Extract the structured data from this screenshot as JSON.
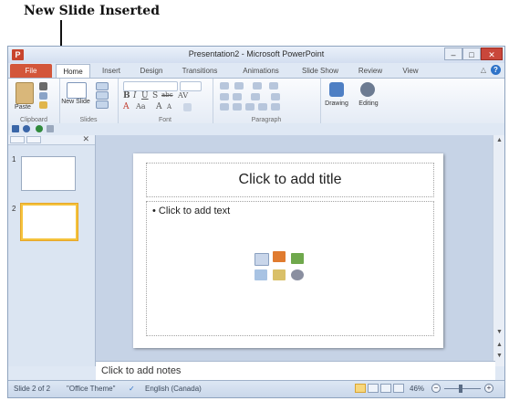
{
  "annotation": {
    "text": "New Slide Inserted"
  },
  "window": {
    "app_icon": "P",
    "title": "Presentation2 - Microsoft PowerPoint",
    "controls": {
      "minimize": "–",
      "maximize": "□",
      "close": "✕"
    }
  },
  "tabs": [
    {
      "label": "File"
    },
    {
      "label": "Home"
    },
    {
      "label": "Insert"
    },
    {
      "label": "Design"
    },
    {
      "label": "Transitions"
    },
    {
      "label": "Animations"
    },
    {
      "label": "Slide Show"
    },
    {
      "label": "Review"
    },
    {
      "label": "View"
    }
  ],
  "ribbon": {
    "clipboard": {
      "label": "Clipboard",
      "paste": "Paste"
    },
    "slides": {
      "label": "Slides",
      "new_slide": "New Slide"
    },
    "font": {
      "label": "Font"
    },
    "paragraph": {
      "label": "Paragraph"
    },
    "drawing": {
      "label": "Drawing"
    },
    "editing": {
      "label": "Editing"
    }
  },
  "outline": {
    "slides": [
      {
        "number": "1"
      },
      {
        "number": "2"
      }
    ]
  },
  "slide": {
    "title_placeholder": "Click to add title",
    "text_placeholder": "Click to add text"
  },
  "notes": {
    "placeholder": "Click to add notes"
  },
  "status": {
    "slide_info": "Slide 2 of 2",
    "theme": "\"Office Theme\"",
    "language": "English (Canada)",
    "zoom": "46%"
  },
  "colors": {
    "accent": "#d3563a",
    "selection": "#f5c33d",
    "ribbon_bg": "#dfe8f4"
  }
}
